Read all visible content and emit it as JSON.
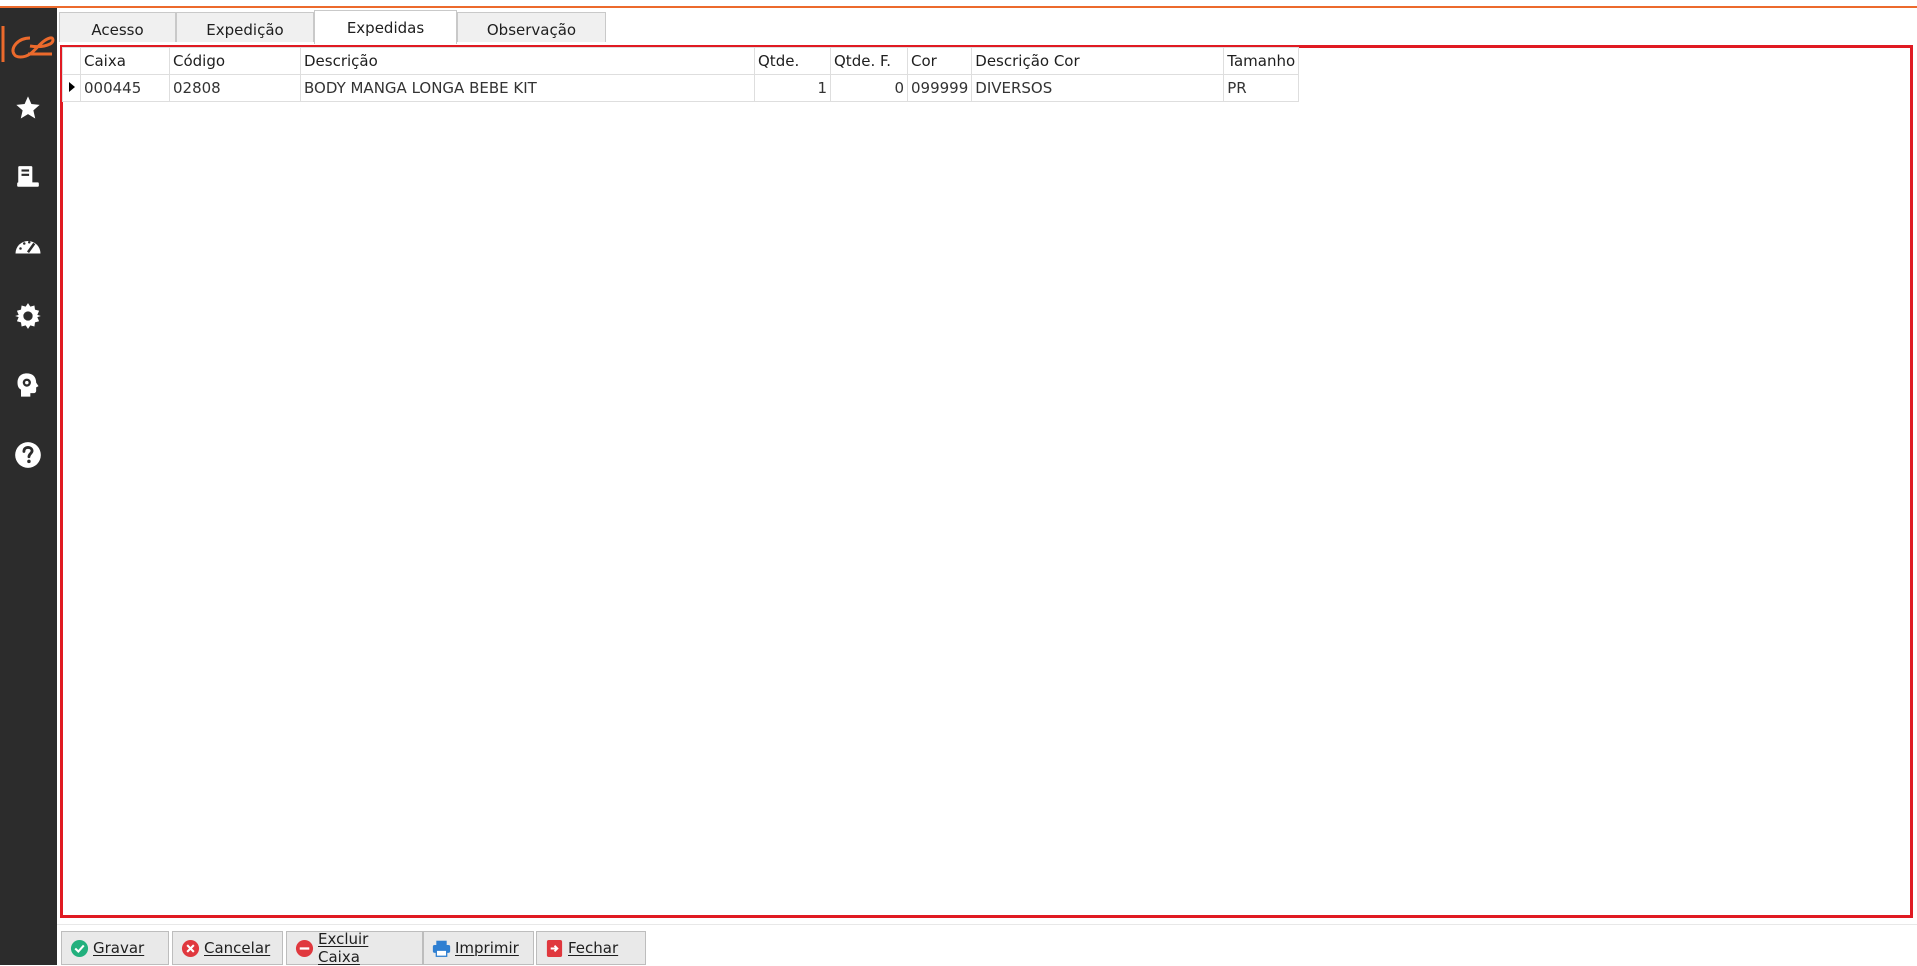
{
  "app": {
    "accent": "#ec6a2c",
    "sidebar_bg": "#2c2c2c",
    "highlight_border": "#e01a22"
  },
  "sidebar": {
    "items": [
      {
        "icon": "star-icon"
      },
      {
        "icon": "register-icon"
      },
      {
        "icon": "dashboard-gauge-icon"
      },
      {
        "icon": "gear-icon"
      },
      {
        "icon": "head-gear-icon"
      },
      {
        "icon": "help-icon"
      }
    ]
  },
  "tabs": [
    {
      "label": "Acesso"
    },
    {
      "label": "Expedição"
    },
    {
      "label": "Expedidas",
      "active": true
    },
    {
      "label": "Observação"
    }
  ],
  "grid": {
    "columns": [
      "Caixa",
      "Código",
      "Descrição",
      "Qtde.",
      "Qtde. F.",
      "Cor",
      "Descrição Cor",
      "Tamanho"
    ],
    "rows": [
      {
        "caixa": "000445",
        "codigo": "02808",
        "descricao": "BODY MANGA LONGA BEBE KIT",
        "qtde": "1",
        "qtde_f": "0",
        "cor": "099999",
        "descricao_cor": "DIVERSOS",
        "tamanho": "PR"
      }
    ]
  },
  "footer": {
    "gravar": "Gravar",
    "cancelar": "Cancelar",
    "excluir_caixa": "Excluir Caixa",
    "imprimir": "Imprimir",
    "fechar": "Fechar"
  }
}
